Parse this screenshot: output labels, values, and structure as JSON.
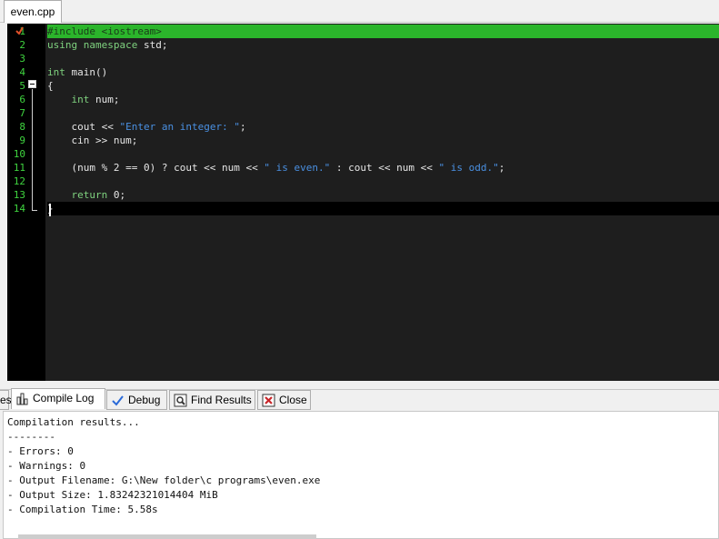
{
  "file_tab": {
    "label": "even.cpp"
  },
  "editor": {
    "lines": [
      {
        "num": "1",
        "html": "<span class=\"t-pp\">#include &lt;iostream&gt;</span>"
      },
      {
        "num": "2",
        "html": "<span class=\"t-kw\">using namespace</span> std;"
      },
      {
        "num": "3",
        "html": ""
      },
      {
        "num": "4",
        "html": "<span class=\"t-kw\">int</span> main()"
      },
      {
        "num": "5",
        "html": "{"
      },
      {
        "num": "6",
        "html": "    <span class=\"t-kw\">int</span> num;"
      },
      {
        "num": "7",
        "html": ""
      },
      {
        "num": "8",
        "html": "    cout &lt;&lt; <span class=\"t-str\">\"Enter an integer: \"</span>;"
      },
      {
        "num": "9",
        "html": "    cin &gt;&gt; num;"
      },
      {
        "num": "10",
        "html": ""
      },
      {
        "num": "11",
        "html": "    (num % 2 == 0) ? cout &lt;&lt; num &lt;&lt; <span class=\"t-str\">\" is even.\"</span> : cout &lt;&lt; num &lt;&lt; <span class=\"t-str\">\" is odd.\"</span>;"
      },
      {
        "num": "12",
        "html": ""
      },
      {
        "num": "13",
        "html": "    <span class=\"t-kw\">return</span> 0;"
      },
      {
        "num": "14",
        "html": "}"
      }
    ]
  },
  "bottom_tabs": {
    "partial": "es",
    "compile_log": "Compile Log",
    "debug": "Debug",
    "find_results": "Find Results",
    "close": "Close"
  },
  "compile_log": {
    "lines": [
      "Compilation results...",
      "--------",
      "- Errors: 0",
      "- Warnings: 0",
      "- Output Filename: G:\\New folder\\c programs\\even.exe",
      "- Output Size: 1.83242321014404 MiB",
      "- Compilation Time: 5.58s"
    ]
  },
  "colors": {
    "line_number": "#3fd43f",
    "highlight_line": "#2bb52b",
    "editor_bg": "#1e1e1e",
    "string": "#4a90e2"
  }
}
